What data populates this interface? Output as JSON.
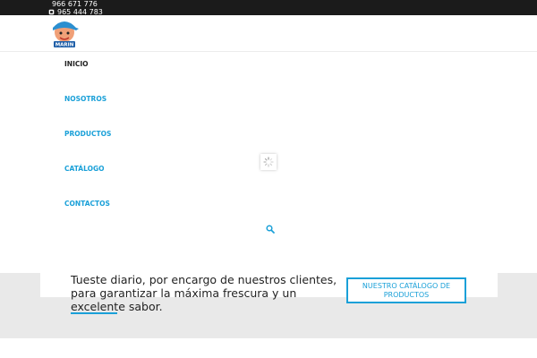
{
  "topbar": {
    "phone_1": "966 671 776",
    "phone_2": "965 444 783",
    "phone_icon": "phone-icon"
  },
  "header": {
    "logo_text": "MARIN",
    "nav": [
      {
        "label": "INICIO",
        "active": true
      },
      {
        "label": "NOSOTROS",
        "active": false
      },
      {
        "label": "PRODUCTOS",
        "active": false
      },
      {
        "label": "CATÁLOGO",
        "active": false
      },
      {
        "label": "CONTACTOS",
        "active": false
      }
    ],
    "search_icon": "search-icon"
  },
  "loader_icon": "spinner-icon",
  "promo": {
    "tagline_line1": "Tueste diario, por encargo de nuestros clientes,",
    "tagline_line2": "para garantizar la máxima frescura y un",
    "tagline_line3_underlined": "excelente",
    "tagline_line3_rest": " sabor.",
    "cta_label": "NUESTRO CATÁLOGO DE PRODUCTOS"
  },
  "colors": {
    "accent": "#1aa0d8",
    "topbar_bg": "#1b1b1b",
    "band_bg": "#e9e9e9",
    "text": "#222222"
  }
}
